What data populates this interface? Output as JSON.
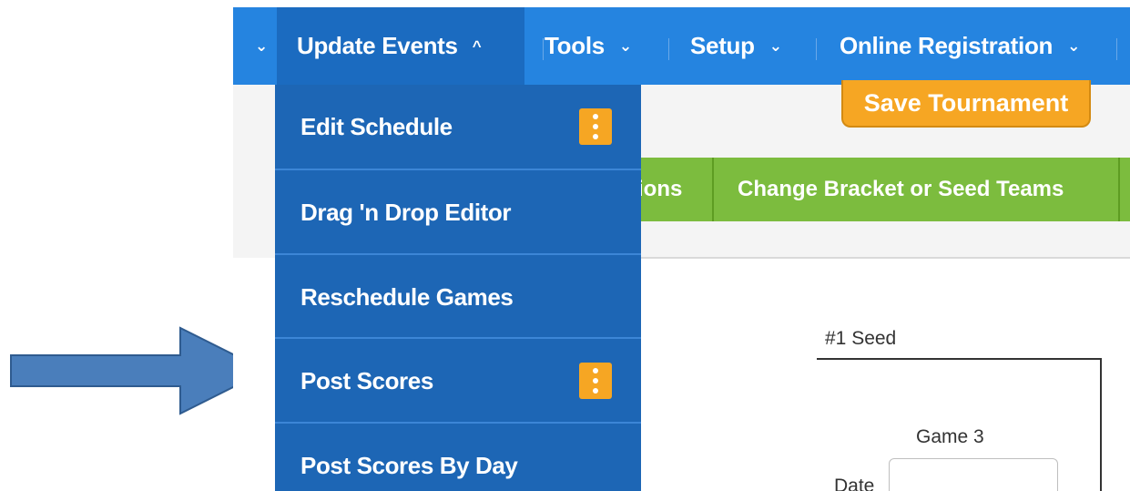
{
  "navbar": {
    "prev_caret": "⌄",
    "items": [
      {
        "label": "Update Events",
        "caret": "^"
      },
      {
        "label": "Tools",
        "caret": "⌄"
      },
      {
        "label": "Setup",
        "caret": "⌄"
      },
      {
        "label": "Online Registration",
        "caret": "⌄"
      }
    ]
  },
  "toolbar": {
    "save_label": "Save Tournament"
  },
  "tabs": [
    {
      "label": "ions"
    },
    {
      "label": "Change Bracket or Seed Teams"
    }
  ],
  "dropdown": {
    "items": [
      {
        "label": "Edit Schedule",
        "has_menu": true
      },
      {
        "label": "Drag 'n Drop Editor",
        "has_menu": false
      },
      {
        "label": "Reschedule Games",
        "has_menu": false
      },
      {
        "label": "Post Scores",
        "has_menu": true
      },
      {
        "label": "Post Scores By Day",
        "has_menu": false
      }
    ]
  },
  "bracket": {
    "seed_label": "#1 Seed",
    "game_label": "Game 3",
    "date_label": "Date",
    "date_value": ""
  },
  "colors": {
    "navbar": "#2584e0",
    "navbar_active": "#1b6bc0",
    "dropdown": "#1d66b5",
    "accent_orange": "#f6a623",
    "green_bar": "#7cbc3e",
    "arrow_fill": "#4a7ebb",
    "arrow_stroke": "#2f5b8f"
  },
  "annotation": {
    "arrow_icon": "arrow-right-icon"
  }
}
